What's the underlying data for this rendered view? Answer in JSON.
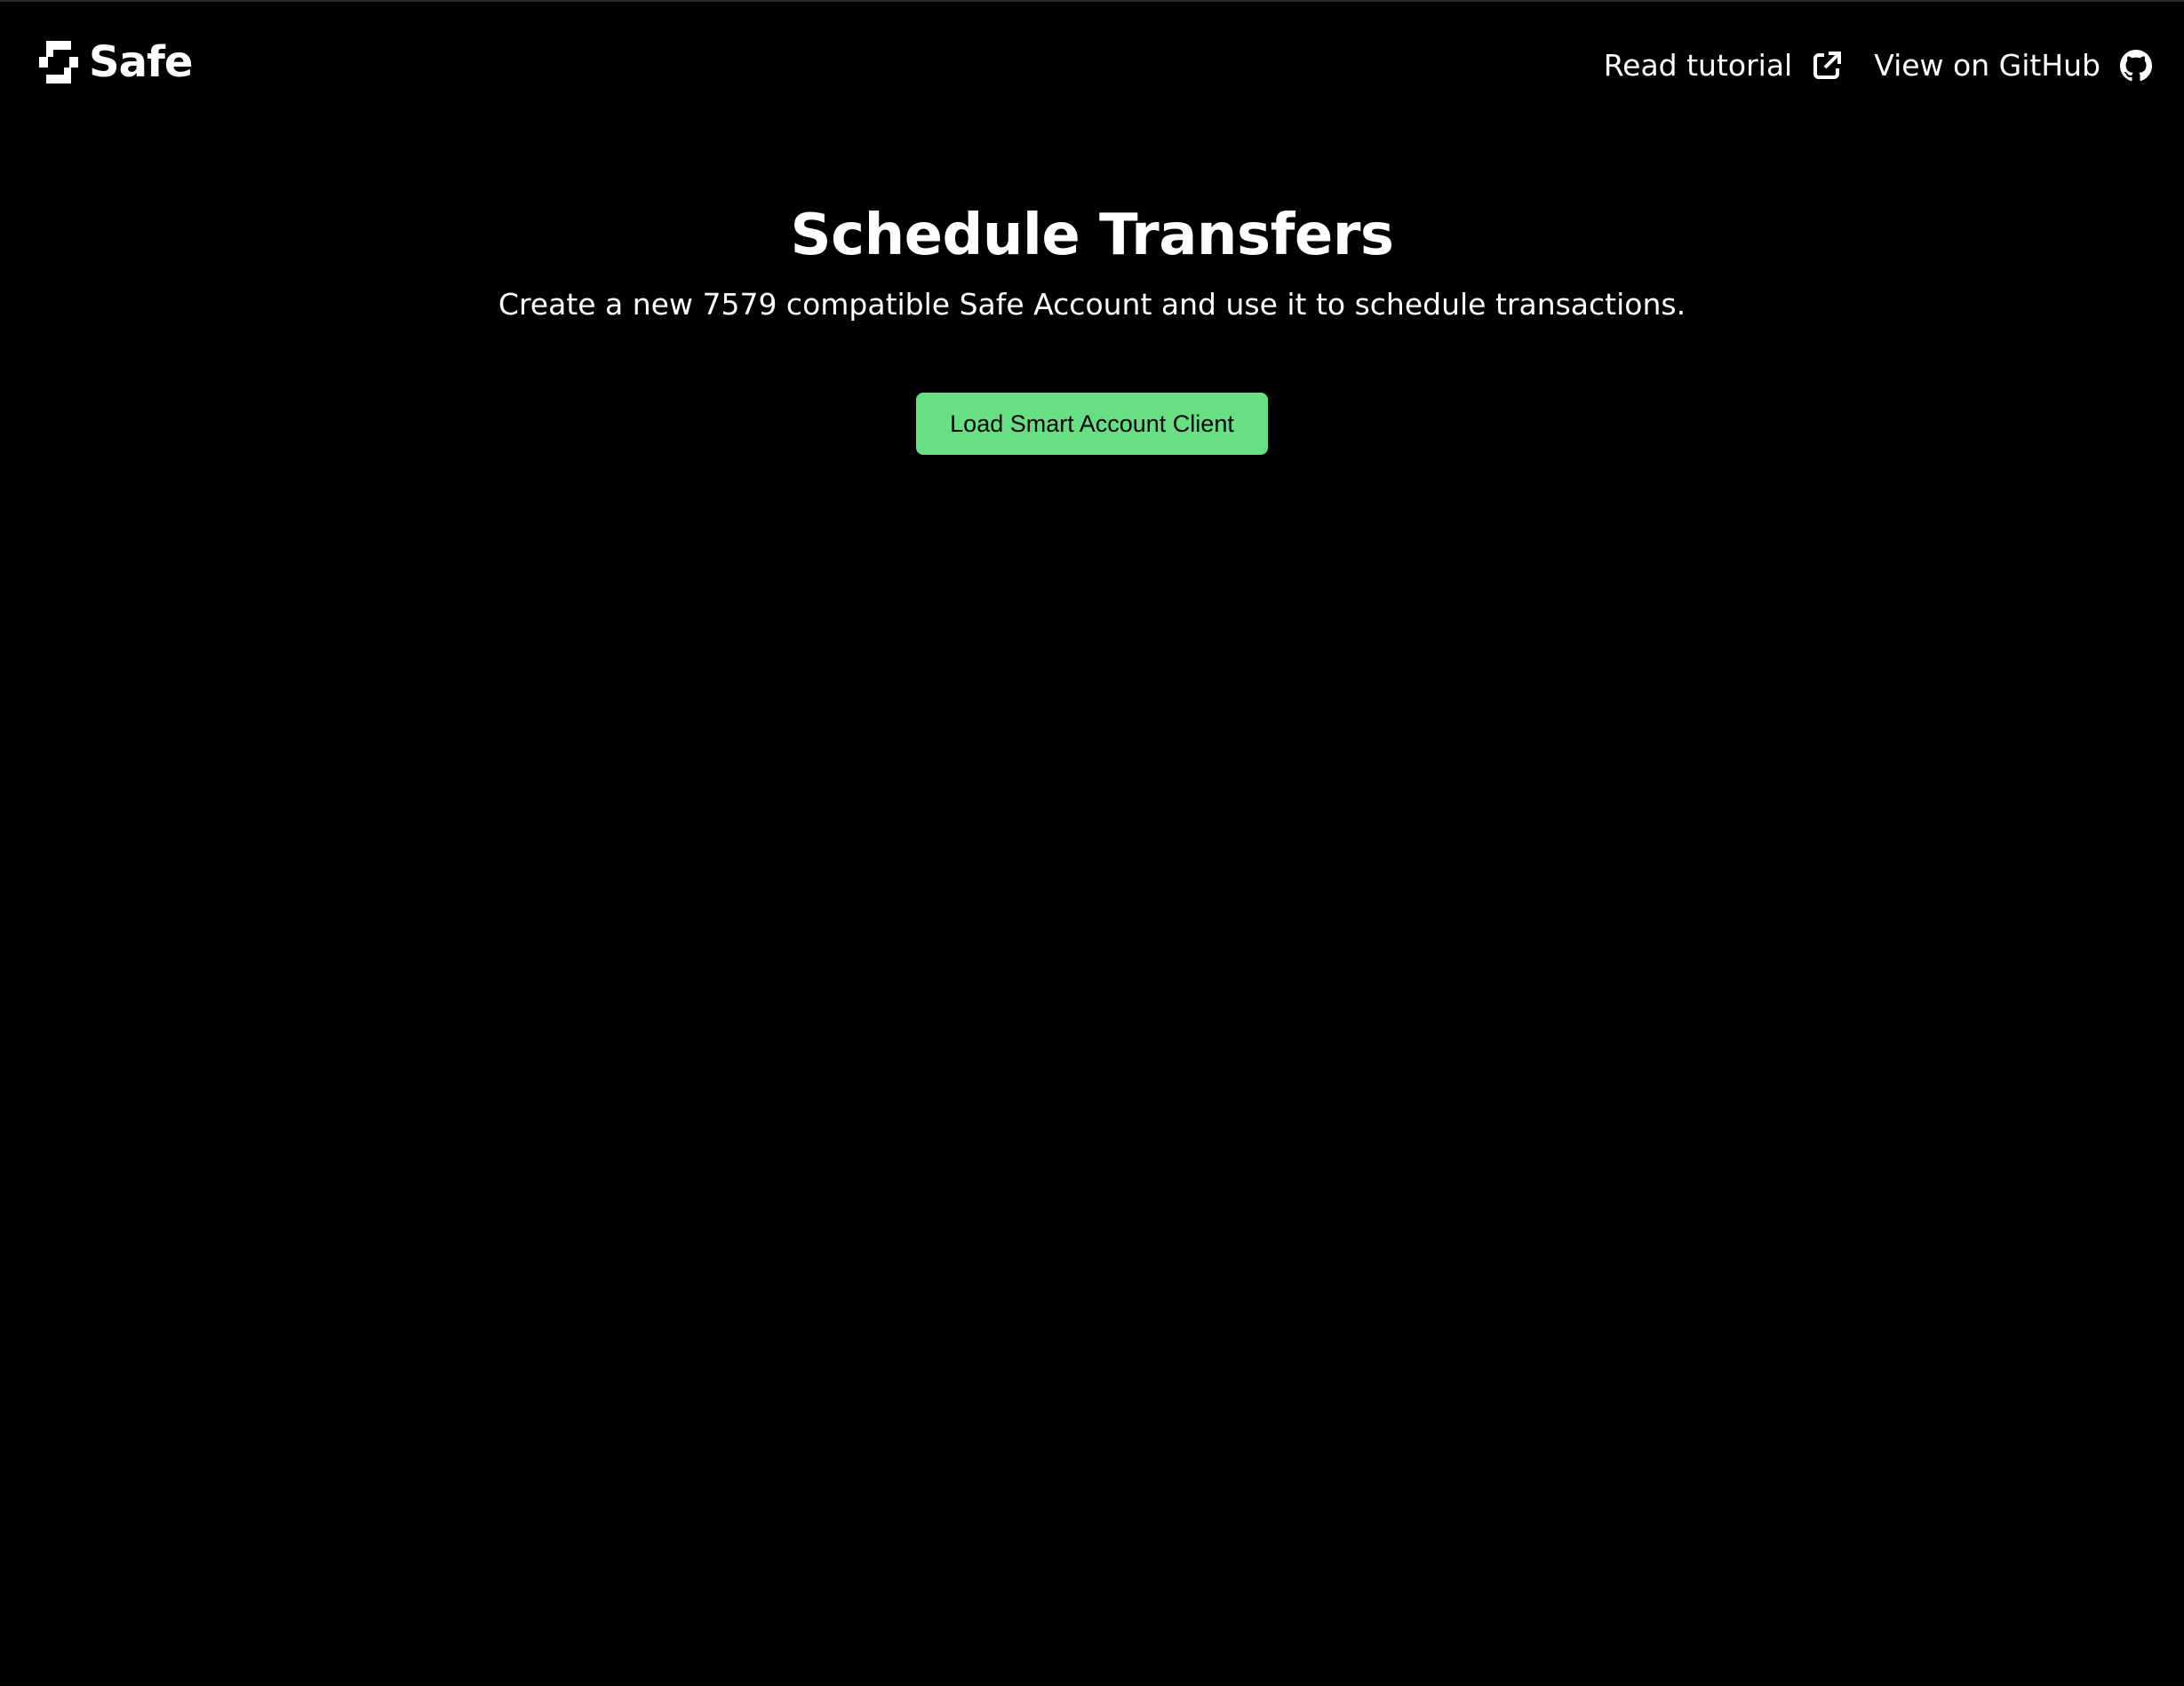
{
  "header": {
    "brand": "Safe",
    "links": [
      {
        "label": "Read tutorial",
        "icon": "external-link-icon"
      },
      {
        "label": "View on GitHub",
        "icon": "github-icon"
      }
    ]
  },
  "hero": {
    "title": "Schedule Transfers",
    "subtitle": "Create a new 7579 compatible Safe Account and use it to schedule transactions.",
    "cta_label": "Load Smart Account Client"
  },
  "colors": {
    "background": "#000000",
    "text": "#ffffff",
    "accent": "#66e083"
  }
}
